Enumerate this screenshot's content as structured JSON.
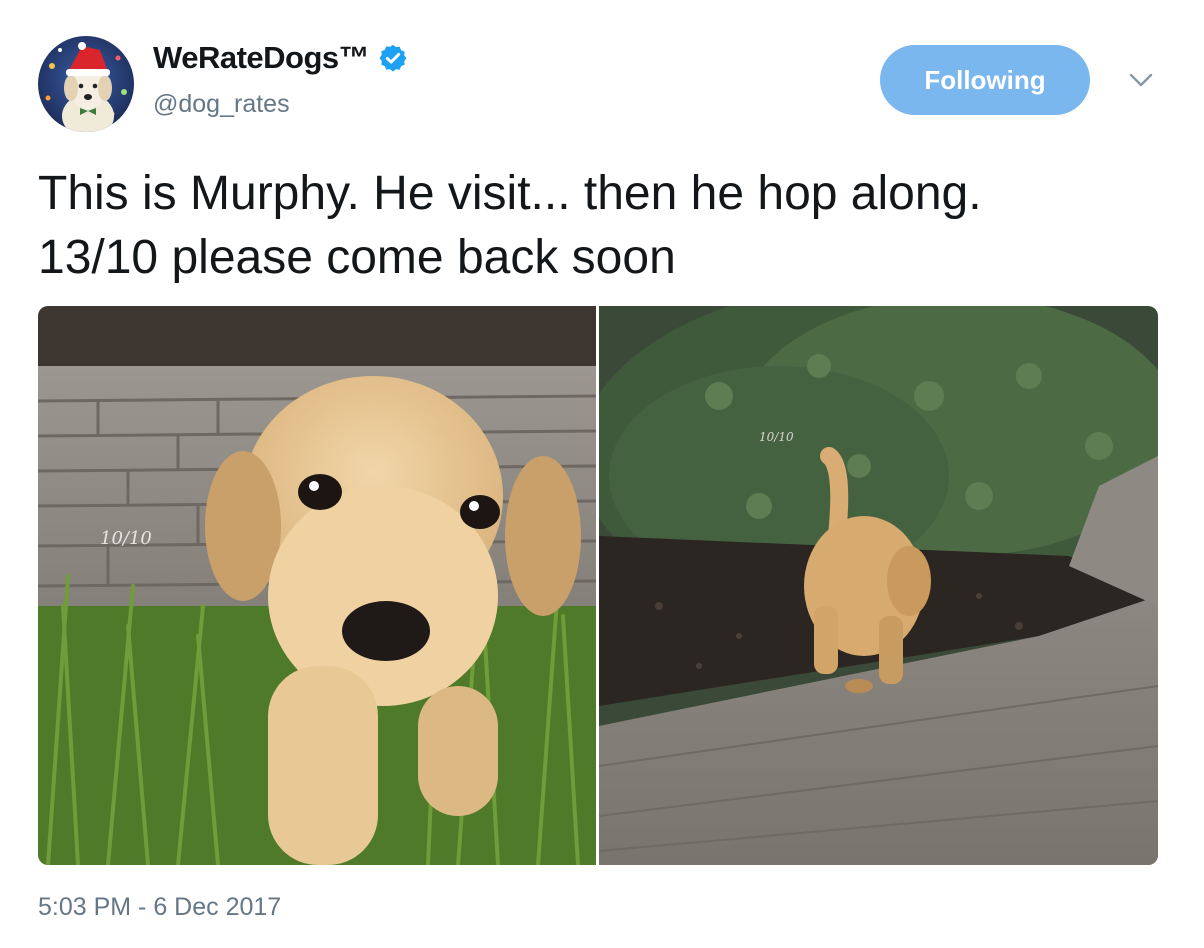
{
  "account": {
    "display_name": "WeRateDogs™",
    "handle": "@dog_rates",
    "verified": true,
    "verified_icon": "verified-badge-icon"
  },
  "follow_button": {
    "label": "Following"
  },
  "more_menu": {
    "icon": "chevron-down-icon"
  },
  "tweet": {
    "text_line_1": "This is Murphy. He visit... then he hop along.",
    "text_line_2": "13/10 please come back soon",
    "timestamp": "5:03 PM - 6 Dec 2017"
  },
  "media": {
    "count": 2,
    "photos": [
      {
        "subject": "golden retriever puppy on grass facing camera",
        "watermark": "10/10"
      },
      {
        "subject": "golden retriever puppy walking away on brick path",
        "watermark": "10/10"
      }
    ]
  },
  "colors": {
    "follow_button_bg": "#7bb7ef",
    "verified_blue": "#1da1f2",
    "secondary_text": "#657786",
    "primary_text": "#14171a"
  }
}
